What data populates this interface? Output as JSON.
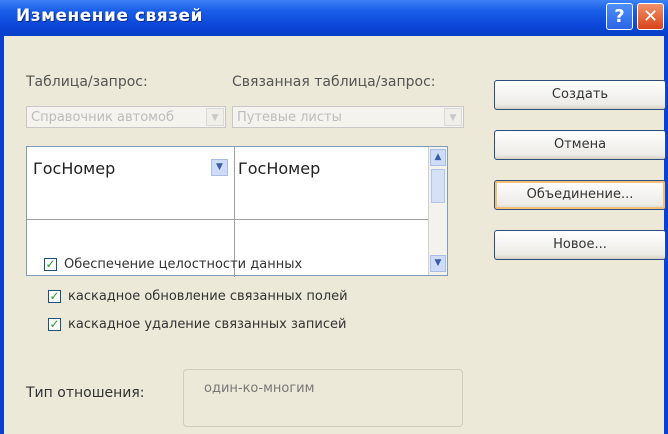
{
  "window": {
    "title": "Изменение связей",
    "help_symbol": "?",
    "close_symbol": "✕"
  },
  "labels": {
    "table_query": "Таблица/запрос:",
    "related_table_query": "Связанная таблица/запрос:",
    "relationship_type": "Тип отношения:"
  },
  "combos": {
    "table": "Справочник автомоб",
    "related_table": "Путевые листы"
  },
  "grid": {
    "rows": [
      {
        "left": "ГосНомер",
        "right": "ГосНомер"
      },
      {
        "left": "",
        "right": ""
      }
    ]
  },
  "options": [
    {
      "label": "Обеспечение целостности данных",
      "checked": true
    },
    {
      "label": "каскадное обновление связанных полей",
      "checked": true
    },
    {
      "label": "каскадное удаление связанных записей",
      "checked": true
    }
  ],
  "relationship_value": "один-ко-многим",
  "buttons": {
    "create": "Создать",
    "cancel": "Отмена",
    "join": "Объединение...",
    "new": "Новое..."
  },
  "colors": {
    "titlebar": "#0b47d8",
    "client": "#ece9d8",
    "close": "#d8431a",
    "checkmark": "#21a121"
  },
  "icons": {
    "help": "question-mark-icon",
    "close": "close-icon",
    "dropdown": "chevron-down-icon",
    "checkbox": "checkmark-icon"
  }
}
